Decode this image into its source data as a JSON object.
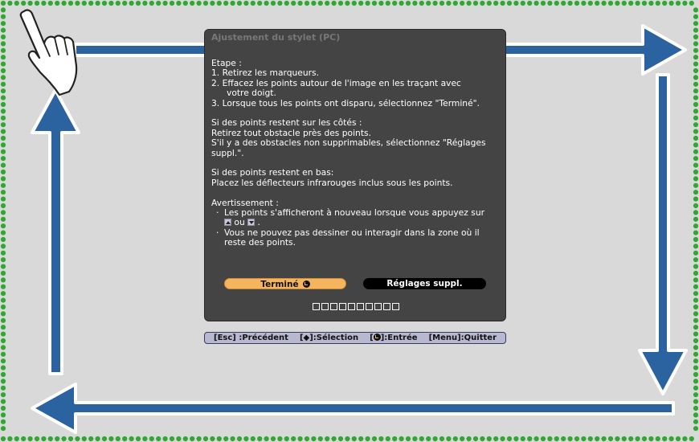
{
  "dialog": {
    "title": "Ajustement du stylet (PC)",
    "steps_heading": "Etape :",
    "steps": [
      {
        "num": "1.",
        "text": "Retirez les marqueurs."
      },
      {
        "num": "2.",
        "text": "Effacez les points autour de l'image en les traçant avec",
        "cont": "votre doigt."
      },
      {
        "num": "3.",
        "text": "Lorsque tous les points ont disparu, sélectionnez \"Terminé\"."
      }
    ],
    "side_heading": "Si des points restent sur les côtés :",
    "side_lines": [
      "Retirez tout obstacle près des points.",
      "S'il y a des obstacles non supprimables, sélectionnez \"Réglages",
      "suppl.\"."
    ],
    "bottom_heading": "Si des points restent en bas:",
    "bottom_line": "Placez les déflecteurs infrarouges inclus sous les points.",
    "warning_heading": "Avertissement :",
    "warning_1a": "Les points s'afficheront à nouveau lorsque vous appuyez sur",
    "warning_1_or": "ou",
    "warning_1_end": ".",
    "warning_2a": "Vous ne pouvez pas dessiner ou interagir dans la zone où il",
    "warning_2b": "reste des points.",
    "bullet_char": "·",
    "done_label": "Terminé",
    "advanced_label": "Réglages suppl.",
    "page_squares": 10
  },
  "help_bar": {
    "esc": "[Esc] :Précédent",
    "select": "[◆]:Sélection",
    "enter_pre": "[",
    "enter_post": "]:Entrée",
    "menu": "[Menu]:Quitter"
  },
  "colors": {
    "arrow": "#2b62a0",
    "dots": "#2fa832",
    "screen": "#d9d9d9"
  },
  "icons": [
    "hand-pointer-icon",
    "arrow-right-icon",
    "arrow-down-icon",
    "arrow-left-icon",
    "arrow-up-icon",
    "enter-icon",
    "up-key-icon",
    "down-key-icon"
  ]
}
